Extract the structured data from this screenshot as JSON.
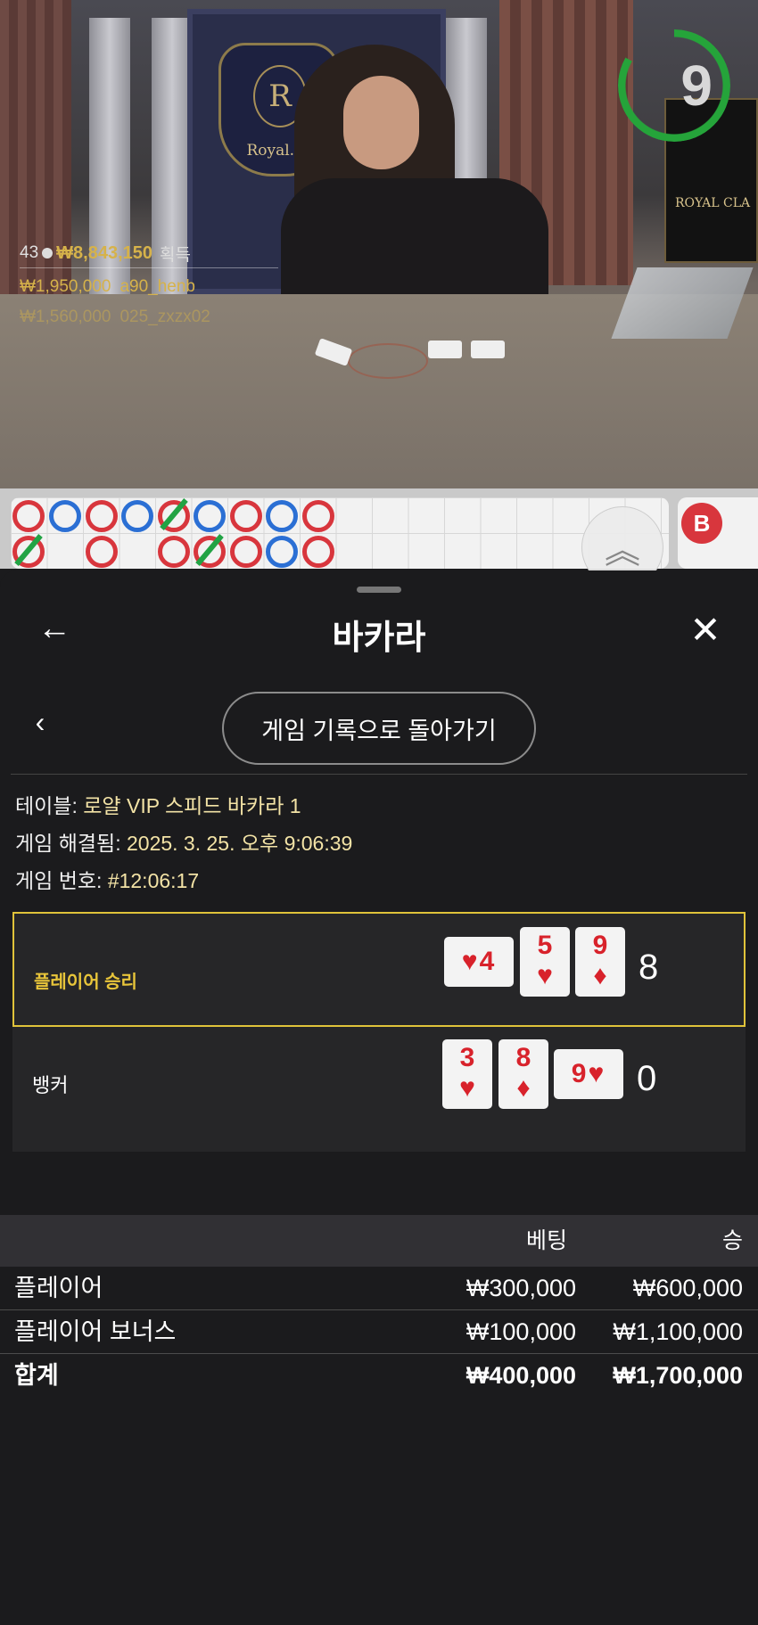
{
  "video": {
    "dealer_table_brand": "Royal.kr",
    "timer": "9",
    "side_sign": "ROYAL CLA",
    "winners_header": {
      "count": "43",
      "amount": "₩8,843,150",
      "label": "획득"
    },
    "winners": [
      {
        "amount": "₩1,950,000",
        "user": "a90_henb"
      },
      {
        "amount": "₩1,560,000",
        "user": "025_zxzx02"
      }
    ],
    "road_badge": "B",
    "colors": {
      "player": "#2b6fd4",
      "banker": "#d8363d",
      "tie": "#22a344",
      "timer": "#25a43a"
    }
  },
  "header": {
    "back_icon": "arrow-left-icon",
    "title": "바카라",
    "close_icon": "close-icon"
  },
  "nav": {
    "prev_icon": "chevron-left-icon",
    "back_to_history": "게임 기록으로 돌아가기"
  },
  "details": {
    "table_label": "테이블:",
    "table_value": "로얄 VIP 스피드 바카라 1",
    "resolved_label": "게임 해결됨:",
    "resolved_value": "2025. 3. 25. 오후 9:06:39",
    "number_label": "게임 번호:",
    "number_value": "#12:06:17"
  },
  "results": {
    "player": {
      "label": "플레이어 승리",
      "cards": [
        {
          "rank": "4",
          "suit": "♥",
          "rotated": true
        },
        {
          "rank": "5",
          "suit": "♥",
          "rotated": false
        },
        {
          "rank": "9",
          "suit": "♦",
          "rotated": false
        }
      ],
      "total": "8"
    },
    "banker": {
      "label": "뱅커",
      "cards": [
        {
          "rank": "3",
          "suit": "♥",
          "rotated": false
        },
        {
          "rank": "8",
          "suit": "♦",
          "rotated": false
        },
        {
          "rank": "9",
          "suit": "♥",
          "rotated": true
        }
      ],
      "total": "0"
    },
    "highlight_color": "#e0c33a"
  },
  "bets": {
    "headers": {
      "bet": "베팅",
      "win": "승"
    },
    "rows": [
      {
        "name": "플레이어",
        "bet": "₩300,000",
        "win": "₩600,000"
      },
      {
        "name": "플레이어 보너스",
        "bet": "₩100,000",
        "win": "₩1,100,000"
      }
    ],
    "total": {
      "name": "합계",
      "bet": "₩400,000",
      "win": "₩1,700,000"
    }
  }
}
